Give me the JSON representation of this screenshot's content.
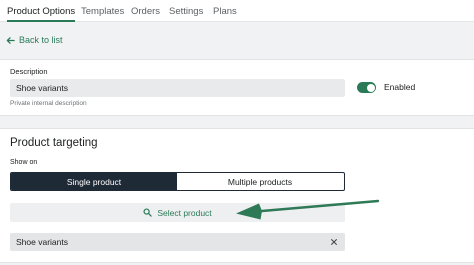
{
  "nav": {
    "tabs": [
      {
        "label": "Product Options",
        "active": true
      },
      {
        "label": "Templates",
        "active": false
      },
      {
        "label": "Orders",
        "active": false
      },
      {
        "label": "Settings",
        "active": false
      },
      {
        "label": "Plans",
        "active": false
      }
    ]
  },
  "back_link": "Back to list",
  "description": {
    "label": "Description",
    "value": "Shoe variants",
    "help_text": "Private internal description",
    "toggle_on": true,
    "toggle_label": "Enabled"
  },
  "targeting": {
    "title": "Product targeting",
    "show_on_label": "Show on",
    "options": [
      "Single product",
      "Multiple products"
    ],
    "selected_index": 0,
    "select_button_label": "Select product",
    "selected_item": "Shoe variants"
  },
  "colors": {
    "accent": "#2a7a57",
    "segment_dark": "#1f2a37"
  },
  "icons": {
    "back": "arrow-left-icon",
    "search": "search-icon",
    "remove": "close-icon"
  }
}
